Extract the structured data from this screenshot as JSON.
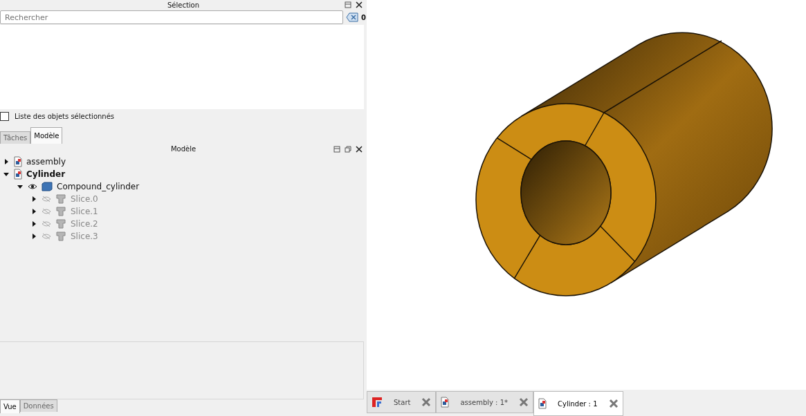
{
  "selection_panel": {
    "title": "Sélection",
    "search": {
      "placeholder": "Rechercher"
    },
    "count": "0",
    "list_checkbox": {
      "label": "Liste des objets sélectionnés",
      "checked": false
    }
  },
  "combo_tabs": [
    {
      "label": "Tâches",
      "selected": false
    },
    {
      "label": "Modèle",
      "selected": true
    }
  ],
  "model_panel": {
    "title": "Modèle",
    "tree": [
      {
        "label": "assembly",
        "kind": "document",
        "expanded": false,
        "active": false
      },
      {
        "label": "Cylinder",
        "kind": "document",
        "expanded": true,
        "active": true,
        "children": [
          {
            "label": "Compound_cylinder",
            "kind": "compound",
            "expanded": true,
            "visible": true,
            "children": [
              {
                "label": "Slice.0",
                "kind": "slice",
                "expanded": false,
                "visible": false
              },
              {
                "label": "Slice.1",
                "kind": "slice",
                "expanded": false,
                "visible": false
              },
              {
                "label": "Slice.2",
                "kind": "slice",
                "expanded": false,
                "visible": false
              },
              {
                "label": "Slice.3",
                "kind": "slice",
                "expanded": false,
                "visible": false
              }
            ]
          }
        ]
      }
    ]
  },
  "property_tabs": [
    {
      "label": "Vue",
      "selected": true
    },
    {
      "label": "Données",
      "selected": false
    }
  ],
  "document_tabs": [
    {
      "label": "Start",
      "kind": "start",
      "selected": false
    },
    {
      "label": "assembly : 1*",
      "kind": "document",
      "selected": false
    },
    {
      "label": "Cylinder : 1",
      "kind": "document",
      "selected": true
    }
  ]
}
